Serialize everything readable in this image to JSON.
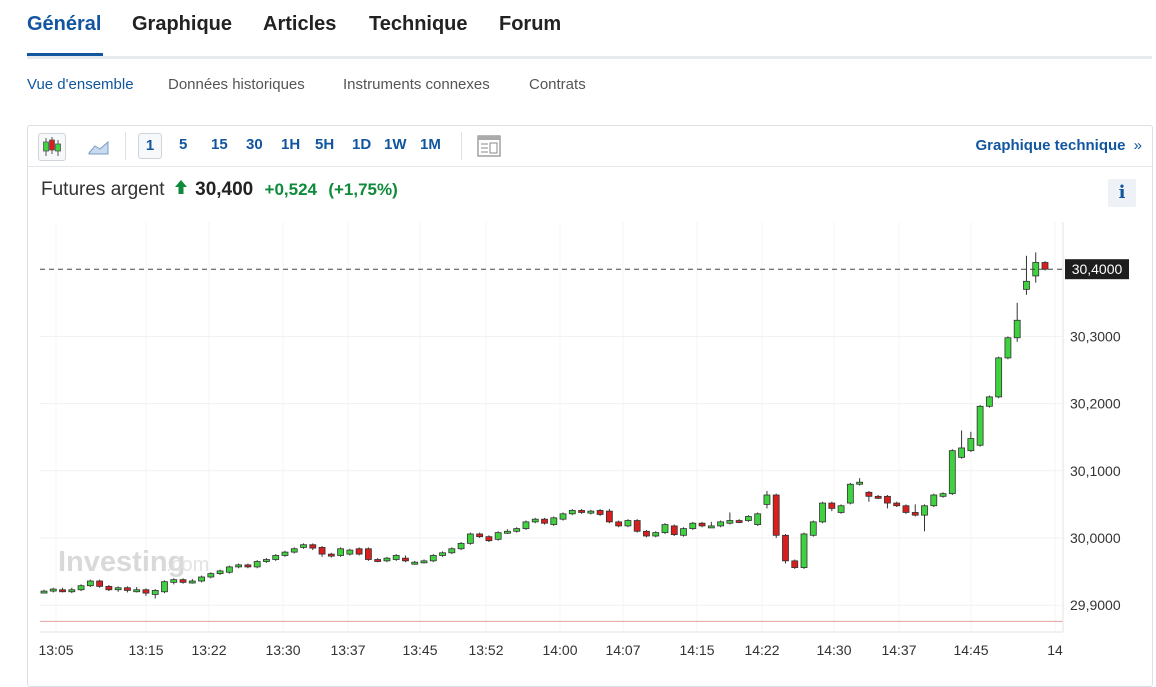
{
  "tabs": [
    {
      "label": "Général",
      "active": true
    },
    {
      "label": "Graphique",
      "active": false
    },
    {
      "label": "Articles",
      "active": false
    },
    {
      "label": "Technique",
      "active": false
    },
    {
      "label": "Forum",
      "active": false
    }
  ],
  "subnav": [
    {
      "label": "Vue d'ensemble",
      "active": true
    },
    {
      "label": "Données historiques",
      "active": false
    },
    {
      "label": "Instruments connexes",
      "active": false
    },
    {
      "label": "Contrats",
      "active": false
    }
  ],
  "toolbar": {
    "timeframes": [
      "1",
      "5",
      "15",
      "30",
      "1H",
      "5H",
      "1D",
      "1W",
      "1M"
    ],
    "active_timeframe": "1",
    "technical_link": "Graphique technique",
    "link_chevron": "»",
    "icons": [
      "candlestick-icon",
      "area-chart-icon",
      "table-view-icon"
    ]
  },
  "instrument": {
    "name": "Futures argent",
    "price": "30,400",
    "change": "+0,524",
    "change_pct": "(+1,75%)",
    "direction": "up",
    "info_label": "i"
  },
  "watermark": {
    "brand": "Investing",
    "suffix": ".com"
  },
  "colors": {
    "accent": "#1256a0",
    "up": "#3fd13f",
    "down": "#d91e1e",
    "positive_text": "#0f8a3a"
  },
  "chart_data": {
    "type": "candlestick",
    "title": "",
    "xlabel": "",
    "ylabel": "",
    "ylim": [
      29.88,
      30.43
    ],
    "y_ticks": [
      "29,9000",
      "30,0000",
      "30,1000",
      "30,2000",
      "30,3000"
    ],
    "y_tick_values": [
      29.9,
      30.0,
      30.1,
      30.2,
      30.3
    ],
    "x_ticks": [
      "13:05",
      "13:15",
      "13:22",
      "13:30",
      "13:37",
      "13:45",
      "13:52",
      "14:00",
      "14:07",
      "14:15",
      "14:22",
      "14:30",
      "14:37",
      "14:45",
      "14"
    ],
    "last_price_label": "30,4000",
    "last_price": 30.4,
    "reference_line": 29.876,
    "candles": [
      [
        29.921,
        29.921,
        29.919,
        29.923
      ],
      [
        29.921,
        29.924,
        29.919,
        29.926
      ],
      [
        29.923,
        29.922,
        29.919,
        29.926
      ],
      [
        29.921,
        29.923,
        29.918,
        29.926
      ],
      [
        29.923,
        29.929,
        29.921,
        29.931
      ],
      [
        29.929,
        29.936,
        29.927,
        29.938
      ],
      [
        29.936,
        29.928,
        29.926,
        29.938
      ],
      [
        29.928,
        29.923,
        29.921,
        29.93
      ],
      [
        29.923,
        29.926,
        29.92,
        29.928
      ],
      [
        29.926,
        29.922,
        29.919,
        29.928
      ],
      [
        29.922,
        29.923,
        29.919,
        29.927
      ],
      [
        29.923,
        29.918,
        29.914,
        29.925
      ],
      [
        29.916,
        29.922,
        29.91,
        29.924
      ],
      [
        29.92,
        29.935,
        29.918,
        29.937
      ],
      [
        29.934,
        29.938,
        29.931,
        29.94
      ],
      [
        29.938,
        29.934,
        29.932,
        29.94
      ],
      [
        29.934,
        29.936,
        29.932,
        29.939
      ],
      [
        29.936,
        29.942,
        29.934,
        29.944
      ],
      [
        29.942,
        29.947,
        29.94,
        29.949
      ],
      [
        29.947,
        29.951,
        29.945,
        29.953
      ],
      [
        29.949,
        29.957,
        29.947,
        29.959
      ],
      [
        29.957,
        29.96,
        29.955,
        29.962
      ],
      [
        29.96,
        29.957,
        29.955,
        29.962
      ],
      [
        29.957,
        29.965,
        29.955,
        29.967
      ],
      [
        29.965,
        29.968,
        29.963,
        29.97
      ],
      [
        29.968,
        29.974,
        29.966,
        29.976
      ],
      [
        29.974,
        29.979,
        29.972,
        29.981
      ],
      [
        29.979,
        29.984,
        29.977,
        29.986
      ],
      [
        29.986,
        29.99,
        29.984,
        29.992
      ],
      [
        29.99,
        29.985,
        29.982,
        29.992
      ],
      [
        29.986,
        29.976,
        29.972,
        29.988
      ],
      [
        29.976,
        29.973,
        29.971,
        29.978
      ],
      [
        29.974,
        29.984,
        29.972,
        29.986
      ],
      [
        29.976,
        29.982,
        29.974,
        29.984
      ],
      [
        29.984,
        29.976,
        29.974,
        29.986
      ],
      [
        29.984,
        29.968,
        29.966,
        29.986
      ],
      [
        29.968,
        29.966,
        29.964,
        29.97
      ],
      [
        29.966,
        29.97,
        29.964,
        29.972
      ],
      [
        29.968,
        29.974,
        29.966,
        29.976
      ],
      [
        29.97,
        29.966,
        29.964,
        29.974
      ],
      [
        29.962,
        29.964,
        29.96,
        29.966
      ],
      [
        29.964,
        29.966,
        29.962,
        29.968
      ],
      [
        29.966,
        29.974,
        29.964,
        29.976
      ],
      [
        29.974,
        29.978,
        29.972,
        29.98
      ],
      [
        29.978,
        29.984,
        29.976,
        29.986
      ],
      [
        29.984,
        29.992,
        29.982,
        29.994
      ],
      [
        29.992,
        30.006,
        29.99,
        30.008
      ],
      [
        30.006,
        30.002,
        30.0,
        30.008
      ],
      [
        30.002,
        29.996,
        29.994,
        30.004
      ],
      [
        29.998,
        30.008,
        29.996,
        30.01
      ],
      [
        30.008,
        30.01,
        30.006,
        30.013
      ],
      [
        30.01,
        30.014,
        30.008,
        30.016
      ],
      [
        30.014,
        30.024,
        30.012,
        30.026
      ],
      [
        30.024,
        30.028,
        30.022,
        30.03
      ],
      [
        30.028,
        30.022,
        30.02,
        30.03
      ],
      [
        30.02,
        30.03,
        30.018,
        30.032
      ],
      [
        30.028,
        30.036,
        30.026,
        30.038
      ],
      [
        30.036,
        30.041,
        30.034,
        30.043
      ],
      [
        30.041,
        30.038,
        30.036,
        30.043
      ],
      [
        30.037,
        30.04,
        30.035,
        30.042
      ],
      [
        30.041,
        30.035,
        30.033,
        30.043
      ],
      [
        30.04,
        30.024,
        30.022,
        30.043
      ],
      [
        30.024,
        30.018,
        30.016,
        30.026
      ],
      [
        30.018,
        30.026,
        30.016,
        30.028
      ],
      [
        30.026,
        30.01,
        30.008,
        30.028
      ],
      [
        30.01,
        30.003,
        30.001,
        30.012
      ],
      [
        30.003,
        30.008,
        30.001,
        30.01
      ],
      [
        30.008,
        30.02,
        30.006,
        30.022
      ],
      [
        30.018,
        30.005,
        30.003,
        30.02
      ],
      [
        30.004,
        30.014,
        30.002,
        30.016
      ],
      [
        30.014,
        30.022,
        30.012,
        30.024
      ],
      [
        30.022,
        30.018,
        30.016,
        30.024
      ],
      [
        30.018,
        30.018,
        30.016,
        30.024
      ],
      [
        30.018,
        30.024,
        30.016,
        30.026
      ],
      [
        30.022,
        30.026,
        30.02,
        30.038
      ],
      [
        30.026,
        30.024,
        30.022,
        30.028
      ],
      [
        30.026,
        30.032,
        30.024,
        30.034
      ],
      [
        30.02,
        30.036,
        30.018,
        30.038
      ],
      [
        30.05,
        30.064,
        30.044,
        30.07
      ],
      [
        30.064,
        30.004,
        30.0,
        30.066
      ],
      [
        30.004,
        29.966,
        29.962,
        30.006
      ],
      [
        29.966,
        29.956,
        29.954,
        29.968
      ],
      [
        29.956,
        30.006,
        29.954,
        30.008
      ],
      [
        30.004,
        30.024,
        30.002,
        30.026
      ],
      [
        30.024,
        30.052,
        30.022,
        30.054
      ],
      [
        30.052,
        30.044,
        30.04,
        30.054
      ],
      [
        30.038,
        30.048,
        30.036,
        30.05
      ],
      [
        30.052,
        30.08,
        30.05,
        30.082
      ],
      [
        30.08,
        30.083,
        30.078,
        30.089
      ],
      [
        30.068,
        30.062,
        30.054,
        30.07
      ],
      [
        30.062,
        30.06,
        30.058,
        30.064
      ],
      [
        30.062,
        30.052,
        30.044,
        30.064
      ],
      [
        30.052,
        30.048,
        30.046,
        30.054
      ],
      [
        30.048,
        30.038,
        30.036,
        30.05
      ],
      [
        30.038,
        30.034,
        30.032,
        30.05
      ],
      [
        30.034,
        30.048,
        30.01,
        30.05
      ],
      [
        30.048,
        30.064,
        30.046,
        30.066
      ],
      [
        30.062,
        30.066,
        30.06,
        30.068
      ],
      [
        30.066,
        30.13,
        30.064,
        30.132
      ],
      [
        30.12,
        30.134,
        30.118,
        30.16
      ],
      [
        30.13,
        30.148,
        30.128,
        30.158
      ],
      [
        30.138,
        30.196,
        30.136,
        30.198
      ],
      [
        30.196,
        30.21,
        30.194,
        30.212
      ],
      [
        30.21,
        30.268,
        30.208,
        30.27
      ],
      [
        30.268,
        30.298,
        30.266,
        30.3
      ],
      [
        30.298,
        30.324,
        30.292,
        30.35
      ],
      [
        30.37,
        30.382,
        30.362,
        30.42
      ],
      [
        30.39,
        30.41,
        30.38,
        30.425
      ],
      [
        30.41,
        30.4,
        30.398,
        30.412
      ]
    ]
  }
}
